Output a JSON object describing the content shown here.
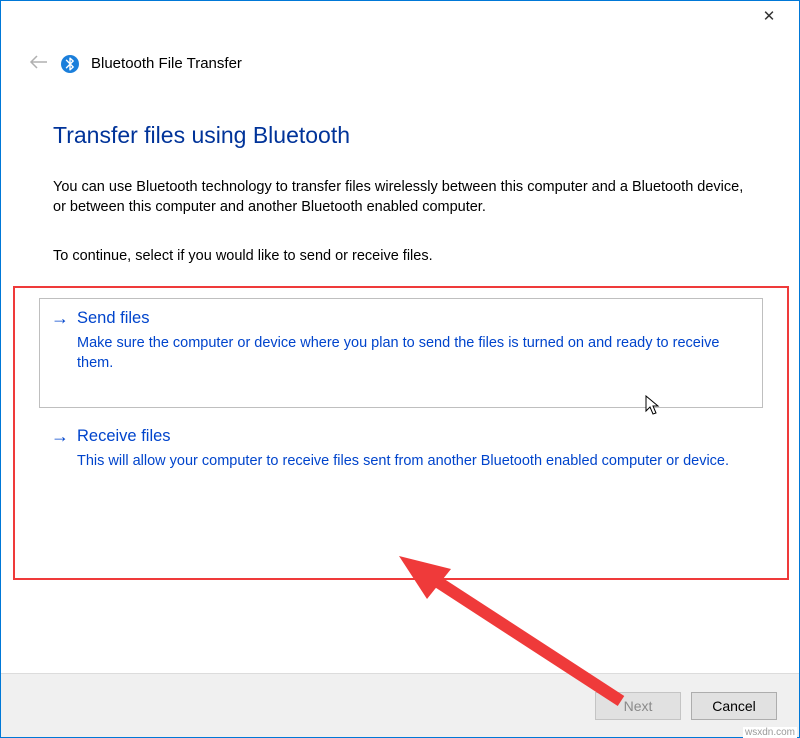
{
  "window": {
    "title": "Bluetooth File Transfer"
  },
  "page": {
    "heading": "Transfer files using Bluetooth",
    "intro": "You can use Bluetooth technology to transfer files wirelessly between this computer and a Bluetooth device, or between this computer and another Bluetooth enabled computer.",
    "instruction": "To continue, select if you would like to send or receive files."
  },
  "options": {
    "send": {
      "title": "Send files",
      "desc": "Make sure the computer or device where you plan to send the files is turned on and ready to receive them."
    },
    "receive": {
      "title": "Receive files",
      "desc": "This will allow your computer to receive files sent from another Bluetooth enabled computer or device."
    }
  },
  "footer": {
    "next": "Next",
    "cancel": "Cancel"
  },
  "watermark": "wsxdn.com"
}
